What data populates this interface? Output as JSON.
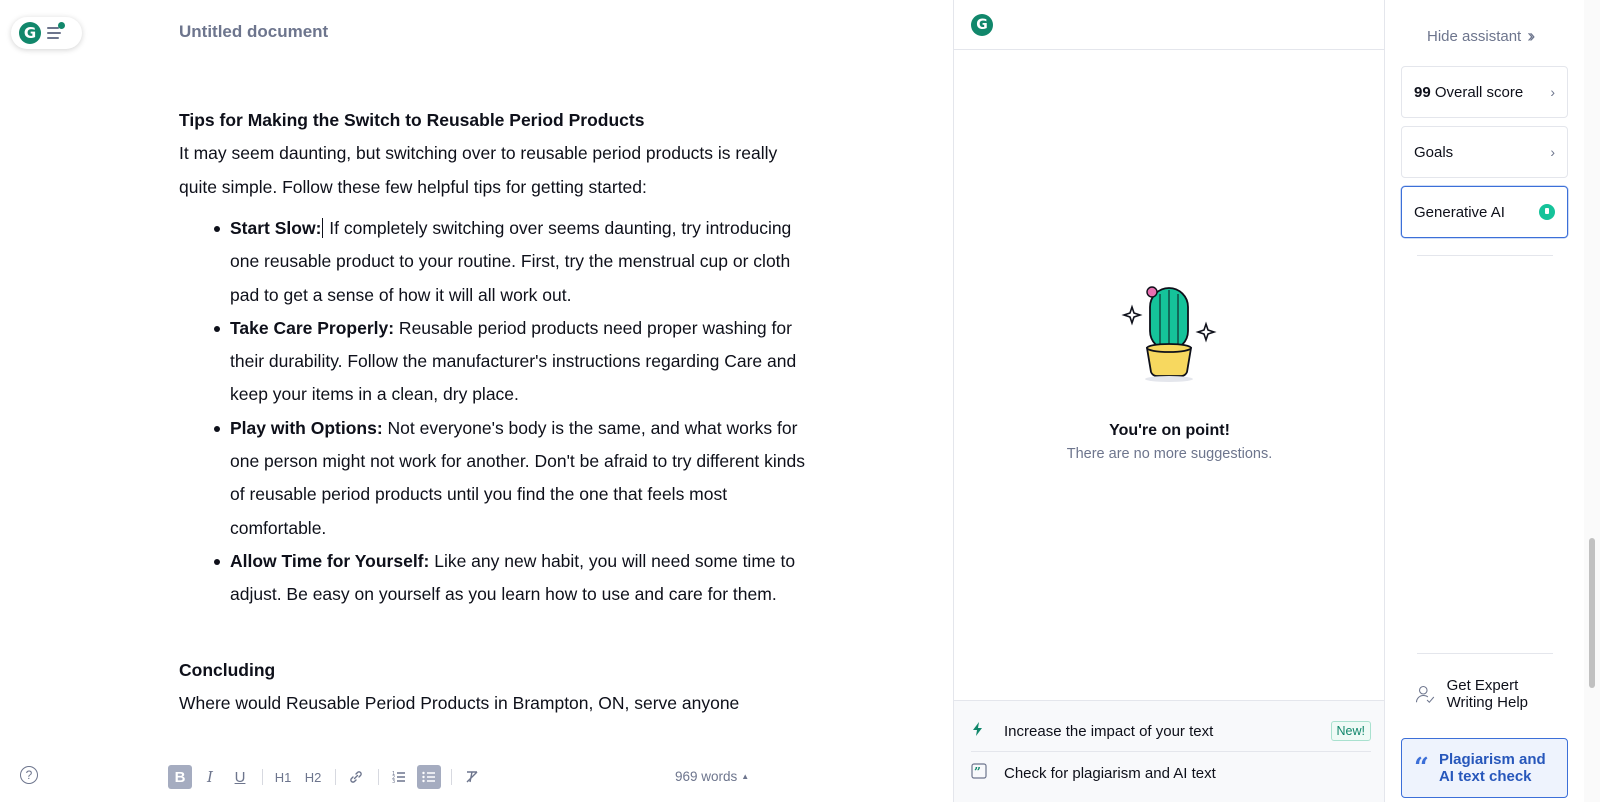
{
  "editor": {
    "doc_title": "Untitled document",
    "heading": "Tips for Making the Switch to Reusable Period Products",
    "intro": "It may seem daunting, but switching over to reusable period products is really quite simple. Follow these few helpful tips for getting started:",
    "bullets": [
      {
        "title": "Start Slow:",
        "text": " If completely switching over seems daunting, try introducing one reusable product to your routine. First, try the menstrual cup or cloth pad to get a sense of how it will all work out."
      },
      {
        "title": "Take Care Properly:",
        "text": " Reusable period products need proper washing for their durability. Follow the manufacturer's instructions regarding Care and keep your items in a clean, dry place."
      },
      {
        "title": "Play with Options:",
        "text": " Not everyone's body is the same, and what works for one person might not work for another. Don't be afraid to try different kinds of reusable period products until you find the one that feels most comfortable."
      },
      {
        "title": "Allow Time for Yourself:",
        "text": " Like any new habit, you will need some time to adjust. Be easy on yourself as you learn how to use and care for them."
      }
    ],
    "concluding_heading": "Concluding",
    "concluding_text": "Where would Reusable Period Products in Brampton, ON, serve anyone",
    "word_count": "969 words",
    "toolbar": {
      "bold": "B",
      "italic": "I",
      "underline": "U",
      "h1": "H1",
      "h2": "H2"
    }
  },
  "assistant": {
    "empty_title": "You're on point!",
    "empty_sub": "There are no more suggestions.",
    "footer": [
      {
        "icon": "lightning-icon",
        "label": "Increase the impact of your text",
        "badge": "New!"
      },
      {
        "icon": "quote-icon",
        "label": "Check for plagiarism and AI text"
      }
    ]
  },
  "sidebar": {
    "hide_label": "Hide assistant",
    "score_value": "99",
    "score_label": "Overall score",
    "goals_label": "Goals",
    "gen_ai_label": "Generative AI",
    "expert_label": "Get Expert Writing Help",
    "plagiarism_label": "Plagiarism and AI text check"
  },
  "colors": {
    "brand_green": "#11876b",
    "accent_blue": "#3c6fd8",
    "muted_text": "#6d758d"
  }
}
